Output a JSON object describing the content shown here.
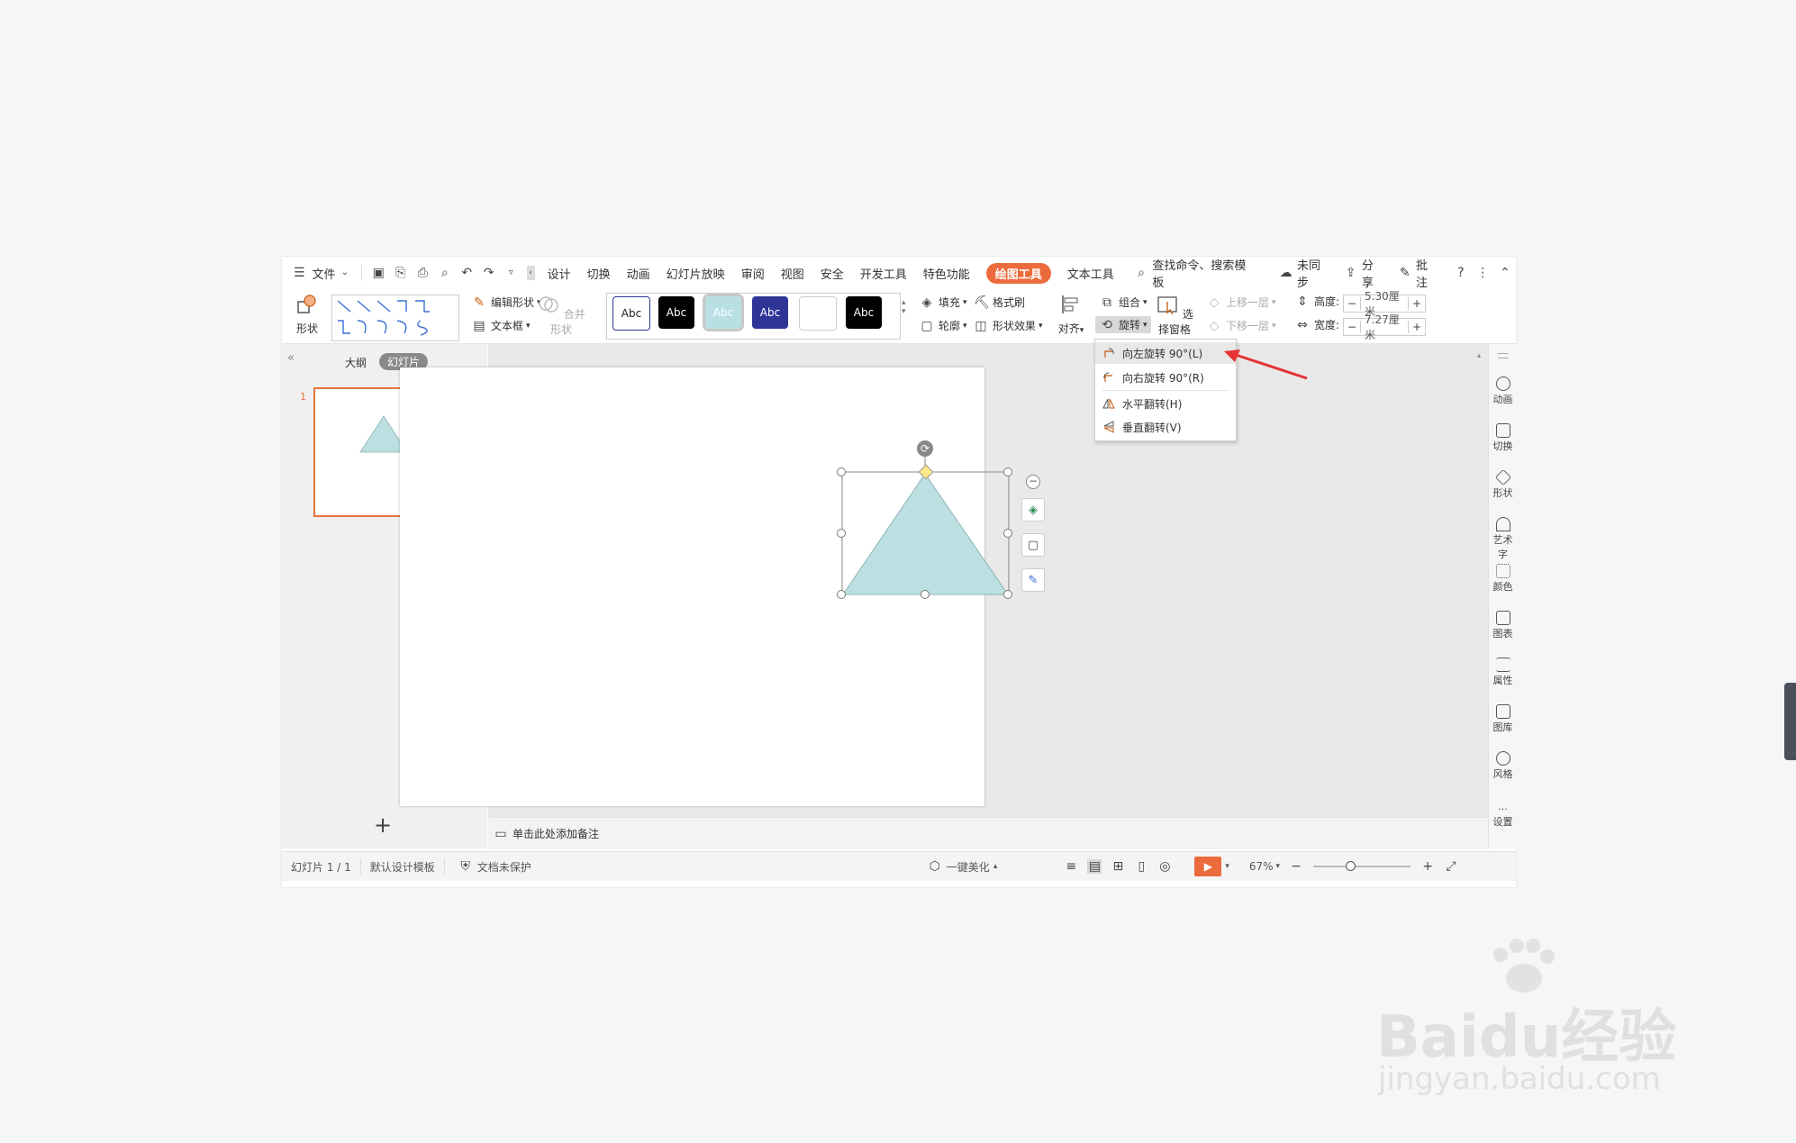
{
  "menu": {
    "file": "文件",
    "tabs": [
      "设计",
      "切换",
      "动画",
      "幻灯片放映",
      "审阅",
      "视图",
      "安全",
      "开发工具",
      "特色功能",
      "绘图工具",
      "文本工具"
    ],
    "active_tab": "绘图工具",
    "search": "查找命令、搜索模板",
    "sync": "未同步",
    "share": "分享",
    "comment": "批注",
    "help": "?"
  },
  "ribbon": {
    "shape": "形状",
    "edit_shape": "编辑形状",
    "text_box": "文本框",
    "merge_shape": "合并形状",
    "style_label": "Abc",
    "fill": "填充",
    "format_brush": "格式刷",
    "outline": "轮廓",
    "shape_effect": "形状效果",
    "align": "对齐",
    "group": "组合",
    "rotate": "旋转",
    "select_pane": "选择窗格",
    "bring_forward": "上移一层",
    "send_backward": "下移一层",
    "height_label": "高度:",
    "height_value": "5.30厘米",
    "width_label": "宽度:",
    "width_value": "7.27厘米",
    "minus": "−",
    "plus": "+"
  },
  "rotate_menu": {
    "items": [
      "向左旋转 90°(L)",
      "向右旋转 90°(R)",
      "水平翻转(H)",
      "垂直翻转(V)"
    ]
  },
  "left_pane": {
    "outline_tab": "大纲",
    "slides_tab": "幻灯片",
    "slide_number": "1",
    "add": "+"
  },
  "notes": {
    "placeholder": "单击此处添加备注"
  },
  "right_sidebar": [
    "动画",
    "切换",
    "形状",
    "艺术字",
    "颜色",
    "图表",
    "属性",
    "图库",
    "风格",
    "设置"
  ],
  "status": {
    "slide_count": "幻灯片 1 / 1",
    "template": "默认设计模板",
    "protection": "文档未保护",
    "beautify": "一键美化",
    "zoom": "67%"
  },
  "colors": {
    "accent": "#ec6b3d",
    "triangle_fill": "#bcdfe1",
    "style_teal": "#b8e0e3",
    "style_navy": "#2e3597"
  },
  "watermark": {
    "logo": "Baidu经验",
    "url": "jingyan.baidu.com"
  }
}
